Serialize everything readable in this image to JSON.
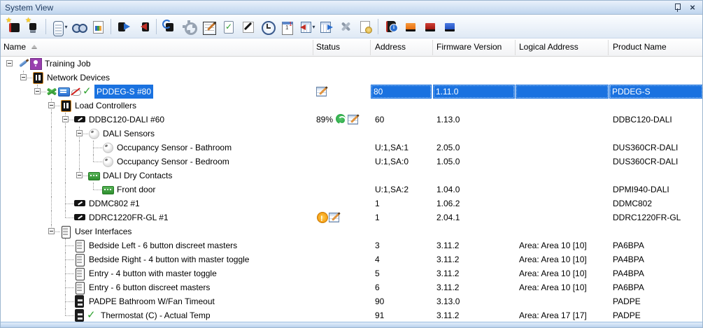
{
  "pane": {
    "title": "System View",
    "controls": [
      "pin-icon",
      "close-icon"
    ]
  },
  "colors": {
    "selection_blue": "#1a72e0",
    "titlebar_top": "#e9f1fb",
    "titlebar_bottom": "#bfd5ee",
    "warning_orange": "#f08a00",
    "ok_green": "#2da12d",
    "folder_gold": "#e8b34b"
  },
  "toolbar": {
    "buttons": [
      {
        "name": "add-device"
      },
      {
        "name": "add-network-device"
      },
      {
        "type": "sep"
      },
      {
        "name": "device-list",
        "caret": true
      },
      {
        "name": "find"
      },
      {
        "name": "report"
      },
      {
        "type": "sep"
      },
      {
        "name": "upload-device"
      },
      {
        "name": "download-device"
      },
      {
        "type": "sep"
      },
      {
        "name": "sync-device"
      },
      {
        "name": "settings"
      },
      {
        "name": "edit-addresses"
      },
      {
        "name": "verify"
      },
      {
        "name": "wizard"
      },
      {
        "name": "schedule"
      },
      {
        "name": "calendar"
      },
      {
        "name": "import-data",
        "caret": true
      },
      {
        "name": "export-data"
      },
      {
        "name": "tools"
      },
      {
        "name": "certificate"
      },
      {
        "type": "sep"
      },
      {
        "name": "product-info"
      },
      {
        "name": "module-orange"
      },
      {
        "name": "module-red"
      },
      {
        "name": "module-blue"
      }
    ]
  },
  "columns": [
    {
      "key": "name",
      "label": "Name",
      "sorted": "ascending"
    },
    {
      "key": "status",
      "label": "Status"
    },
    {
      "key": "address",
      "label": "Address"
    },
    {
      "key": "firmware",
      "label": "Firmware Version"
    },
    {
      "key": "logical",
      "label": "Logical Address"
    },
    {
      "key": "product",
      "label": "Product Name"
    }
  ],
  "tree": {
    "rows": [
      {
        "level": 0,
        "expander": true,
        "icons": [
          "job-brush",
          "job-bulb"
        ],
        "name": "Training Job"
      },
      {
        "level": 1,
        "expander": true,
        "icons": [
          "network-devices"
        ],
        "name": "Network Devices"
      },
      {
        "level": 2,
        "expander": true,
        "icons": [
          "connection",
          "ethernet",
          "cloud-offline",
          "check"
        ],
        "name": "PDDEG-S #80",
        "selected": true,
        "status_icons": [
          "edit-note"
        ],
        "address": "80",
        "firmware": "1.11.0",
        "logical": "",
        "product": "PDDEG-S"
      },
      {
        "level": 3,
        "expander": true,
        "icons": [
          "network-devices"
        ],
        "name": "Load Controllers"
      },
      {
        "level": 4,
        "expander": true,
        "icons": [
          "device"
        ],
        "name": "DDBC120-DALI #60",
        "status_text": "89%",
        "status_icons": [
          "sync",
          "edit-note"
        ],
        "address": "60",
        "firmware": "1.13.0",
        "product": "DDBC120-DALI"
      },
      {
        "level": 5,
        "expander": true,
        "icons": [
          "job-bulb-sensorfolder"
        ],
        "name": "DALI Sensors"
      },
      {
        "level": 6,
        "expander": false,
        "icons": [
          "sensor"
        ],
        "name": "Occupancy Sensor - Bathroom",
        "address": "U:1,SA:1",
        "firmware": "2.05.0",
        "product": "DUS360CR-DALI"
      },
      {
        "level": 6,
        "expander": false,
        "icons": [
          "sensor"
        ],
        "name": "Occupancy Sensor - Bedroom",
        "address": "U:1,SA:0",
        "firmware": "1.05.0",
        "product": "DUS360CR-DALI"
      },
      {
        "level": 5,
        "expander": true,
        "icons": [
          "contact-folder"
        ],
        "name": "DALI Dry Contacts"
      },
      {
        "level": 6,
        "expander": false,
        "icons": [
          "contact"
        ],
        "name": "Front door",
        "address": "U:1,SA:2",
        "firmware": "1.04.0",
        "product": "DPMI940-DALI"
      },
      {
        "level": 4,
        "expander": false,
        "icons": [
          "device"
        ],
        "name": "DDMC802 #1",
        "address": "1",
        "firmware": "1.06.2",
        "product": "DDMC802"
      },
      {
        "level": 4,
        "expander": false,
        "icons": [
          "device"
        ],
        "name": "DDRC1220FR-GL #1",
        "status_icons": [
          "warning",
          "edit-note"
        ],
        "address": "1",
        "firmware": "2.04.1",
        "product": "DDRC1220FR-GL"
      },
      {
        "level": 3,
        "expander": true,
        "icons": [
          "ui-folder"
        ],
        "name": "User Interfaces"
      },
      {
        "level": 4,
        "expander": false,
        "icons": [
          "keypad"
        ],
        "name": "Bedside Left - 6 button discreet masters",
        "address": "3",
        "firmware": "3.11.2",
        "logical": "Area: Area 10 [10]",
        "product": "PA6BPA"
      },
      {
        "level": 4,
        "expander": false,
        "icons": [
          "keypad"
        ],
        "name": "Bedside Right - 4 button with master toggle",
        "address": "4",
        "firmware": "3.11.2",
        "logical": "Area: Area 10 [10]",
        "product": "PA4BPA"
      },
      {
        "level": 4,
        "expander": false,
        "icons": [
          "keypad"
        ],
        "name": "Entry - 4 button with master toggle",
        "address": "5",
        "firmware": "3.11.2",
        "logical": "Area: Area 10 [10]",
        "product": "PA4BPA"
      },
      {
        "level": 4,
        "expander": false,
        "icons": [
          "keypad"
        ],
        "name": "Entry - 6 button discreet masters",
        "address": "6",
        "firmware": "3.11.2",
        "logical": "Area: Area 10 [10]",
        "product": "PA6BPA"
      },
      {
        "level": 4,
        "expander": false,
        "icons": [
          "panel"
        ],
        "name": "PADPE Bathroom W/Fan Timeout",
        "address": "90",
        "firmware": "3.13.0",
        "product": "PADPE"
      },
      {
        "level": 4,
        "expander": false,
        "icons": [
          "panel",
          "check"
        ],
        "name": "Thermostat (C) - Actual Temp",
        "address": "91",
        "firmware": "3.11.2",
        "logical": "Area: Area 17 [17]",
        "product": "PADPE"
      }
    ]
  }
}
